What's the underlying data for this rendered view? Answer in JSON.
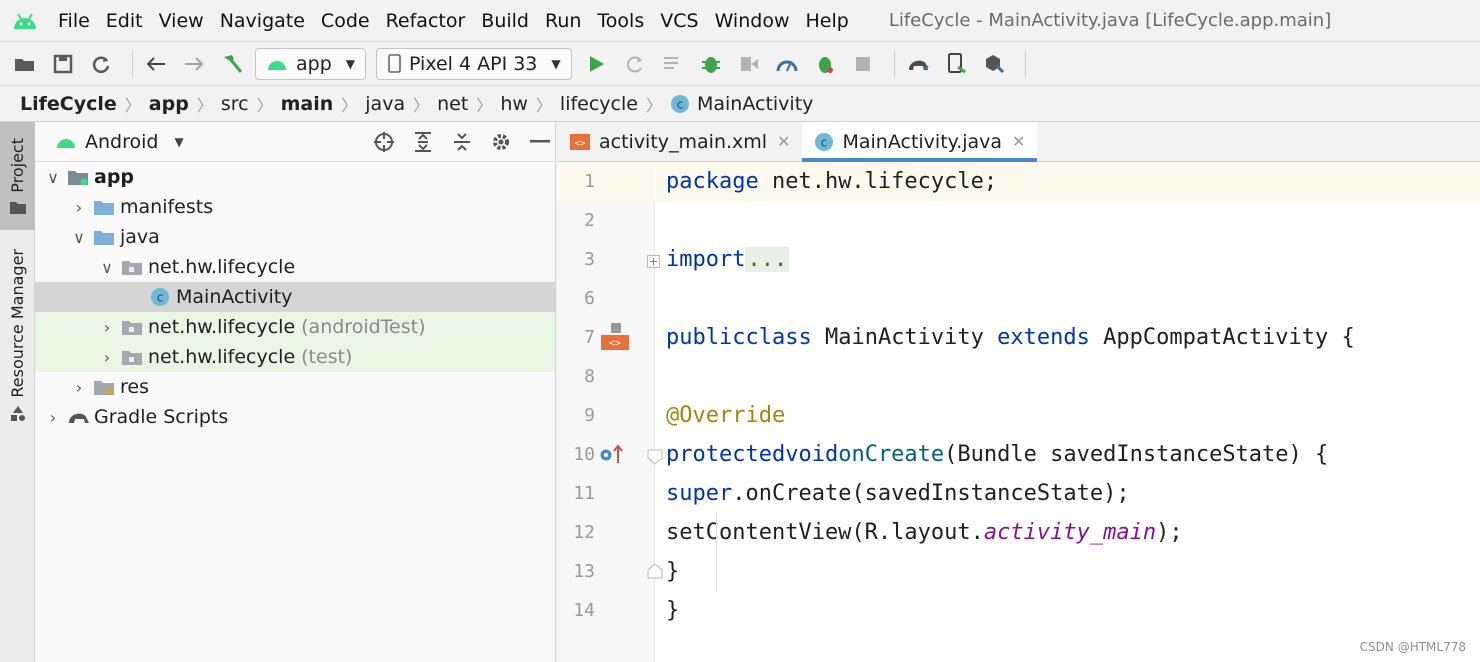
{
  "menubar": {
    "items": [
      "File",
      "Edit",
      "View",
      "Navigate",
      "Code",
      "Refactor",
      "Build",
      "Run",
      "Tools",
      "VCS",
      "Window",
      "Help"
    ],
    "window_title": "LifeCycle - MainActivity.java [LifeCycle.app.main]"
  },
  "toolbar": {
    "run_config": "app",
    "device": "Pixel 4 API 33"
  },
  "breadcrumb": [
    "LifeCycle",
    "app",
    "src",
    "main",
    "java",
    "net",
    "hw",
    "lifecycle",
    "MainActivity"
  ],
  "side_tabs": {
    "project": "Project",
    "resource_manager": "Resource Manager"
  },
  "project_panel": {
    "view_mode": "Android",
    "tree": [
      {
        "label": "app",
        "suffix": "",
        "expanded": true
      },
      {
        "label": "manifests",
        "suffix": "",
        "expanded": false
      },
      {
        "label": "java",
        "suffix": "",
        "expanded": true
      },
      {
        "label": "net.hw.lifecycle",
        "suffix": "",
        "expanded": true
      },
      {
        "label": "MainActivity",
        "suffix": "",
        "selected": true
      },
      {
        "label": "net.hw.lifecycle",
        "suffix": "(androidTest)",
        "expanded": false
      },
      {
        "label": "net.hw.lifecycle",
        "suffix": "(test)",
        "expanded": false
      },
      {
        "label": "res",
        "suffix": "",
        "expanded": false
      },
      {
        "label": "Gradle Scripts",
        "suffix": "",
        "expanded": false
      }
    ]
  },
  "editor": {
    "tabs": [
      {
        "label": "activity_main.xml",
        "active": false
      },
      {
        "label": "MainActivity.java",
        "active": true
      }
    ],
    "line_numbers": [
      "1",
      "2",
      "3",
      "6",
      "7",
      "8",
      "9",
      "10",
      "11",
      "12",
      "13",
      "14"
    ],
    "code": {
      "l1_kw": "package",
      "l1_rest": " net.hw.lifecycle;",
      "l3_kw": "import",
      "l3_fold": "...",
      "l7_kw1": "public",
      "l7_kw2": "class",
      "l7_name": " MainActivity ",
      "l7_kw3": "extends",
      "l7_rest": " AppCompatActivity {",
      "l9_ann": "@Override",
      "l10_kw1": "protected",
      "l10_kw2": "void",
      "l10_fn": "onCreate",
      "l10_rest": "(Bundle savedInstanceState) {",
      "l11_kw": "super",
      "l11_rest": ".onCreate(savedInstanceState);",
      "l12_pre": "setContentView(R.layout.",
      "l12_field": "activity_main",
      "l12_post": ");",
      "l13": "}",
      "l14": "}"
    }
  },
  "watermark": "CSDN @HTML778",
  "colors": {
    "keyword": "#0033b3",
    "annotation": "#9e880d",
    "function": "#00627a",
    "field": "#871094",
    "android_green": "#3ddc84",
    "run_green": "#3fa34d",
    "tab_accent": "#4a88c7"
  }
}
